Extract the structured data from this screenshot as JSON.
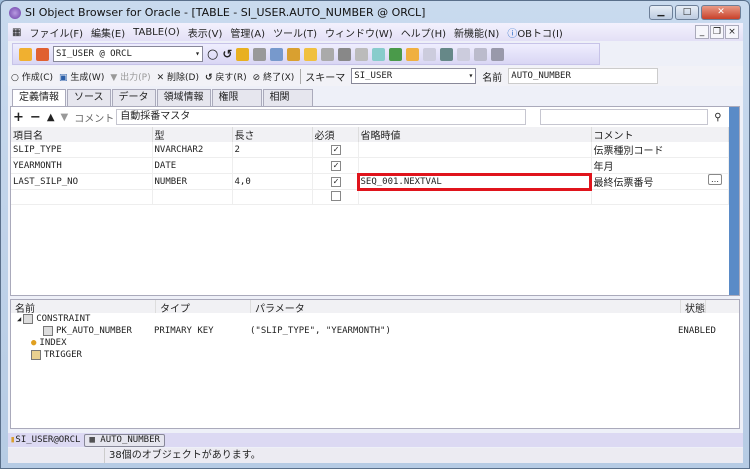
{
  "window": {
    "title": "SI Object Browser for Oracle - [TABLE - SI_USER.AUTO_NUMBER @ ORCL]"
  },
  "menu": [
    "ファイル(F)",
    "編集(E)",
    "TABLE(O)",
    "表示(V)",
    "管理(A)",
    "ツール(T)",
    "ウィンドウ(W)",
    "ヘルプ(H)",
    "新機能(N)",
    "OBトコ(I)"
  ],
  "toolbar": {
    "connection": "SI_USER @ ORCL"
  },
  "actions": {
    "create": "作成(C)",
    "generate": "生成(W)",
    "output": "出力(P)",
    "delete": "削除(D)",
    "revert": "戻す(R)",
    "close": "終了(X)",
    "schema_label": "スキーマ",
    "schema": "SI_USER",
    "name_label": "名前",
    "name": "AUTO_NUMBER"
  },
  "tabs": [
    "定義情報",
    "ソース",
    "データ",
    "領域情報",
    "権限",
    "相関"
  ],
  "comment": {
    "label": "コメント",
    "value": "自動採番マスタ"
  },
  "grid": {
    "headers": [
      "項目名",
      "型",
      "長さ",
      "必須",
      "省略時値",
      "コメント"
    ],
    "rows": [
      {
        "name": "SLIP_TYPE",
        "type": "NVARCHAR2",
        "length": "2",
        "required": true,
        "default": "",
        "comment": "伝票種別コード"
      },
      {
        "name": "YEARMONTH",
        "type": "DATE",
        "length": "",
        "required": true,
        "default": "",
        "comment": "年月"
      },
      {
        "name": "LAST_SILP_NO",
        "type": "NUMBER",
        "length": "4,0",
        "required": true,
        "default": "SEQ_001.NEXTVAL",
        "comment": "最終伝票番号"
      },
      {
        "name": "",
        "type": "",
        "length": "",
        "required": false,
        "default": "",
        "comment": ""
      }
    ]
  },
  "lower": {
    "headers": [
      "名前",
      "タイプ",
      "パラメータ",
      "状態"
    ],
    "constraint": "CONSTRAINT",
    "pk": {
      "name": "PK_AUTO_NUMBER",
      "type": "PRIMARY KEY",
      "params": "(\"SLIP_TYPE\", \"YEARMONTH\")",
      "state": "ENABLED"
    },
    "index": "INDEX",
    "trigger": "TRIGGER"
  },
  "bottom_tabs": [
    "SI_USER@ORCL",
    "AUTO_NUMBER"
  ],
  "status": "38個のオブジェクトがあります。"
}
